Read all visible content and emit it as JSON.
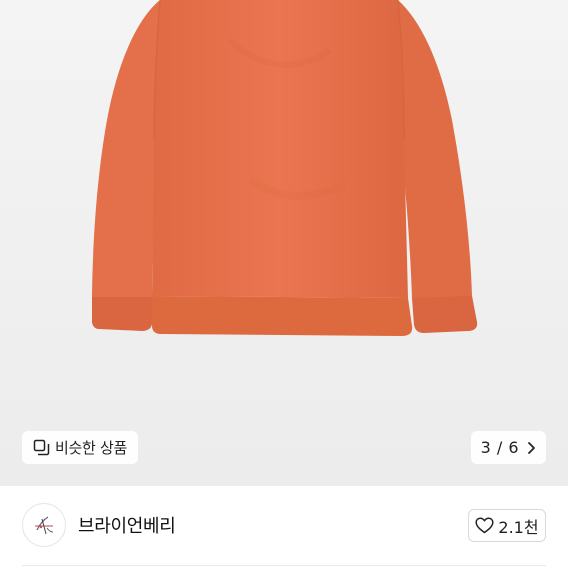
{
  "image_viewer": {
    "similar_products_label": "비슷한 상품",
    "counter_text": "3 / 6",
    "current_index": 3,
    "total_images": 6
  },
  "seller": {
    "name": "브라이언베리",
    "like_count": "2.1천"
  },
  "colors": {
    "sweatshirt": "#e8714a",
    "background": "#f0f0f0"
  },
  "icons": {
    "similar": "stacked-squares-icon",
    "next": "chevron-right-icon",
    "like": "heart-outline-icon"
  }
}
